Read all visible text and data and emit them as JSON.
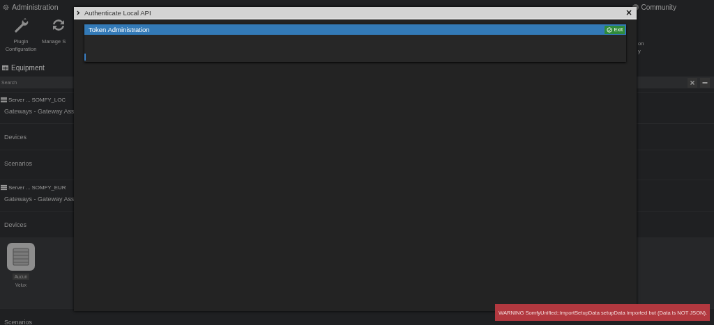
{
  "header": {
    "title": "Administration",
    "community": "Community"
  },
  "admin_tiles": [
    {
      "label": "Plugin Configuration"
    },
    {
      "label": "Manage S"
    }
  ],
  "right_fragments": [
    "on",
    "y"
  ],
  "equipment": {
    "title": "Equipment",
    "search": {
      "placeholder": "Search"
    }
  },
  "servers": [
    {
      "title": "Server ... SOMFY_LOC",
      "sections": [
        {
          "label": "Gateways - Gateway Ass"
        },
        {
          "label": "Devices"
        },
        {
          "label": "Scenarios"
        }
      ]
    },
    {
      "title": "Server ... SOMFY_EUR",
      "sections": [
        {
          "label": "Gateways - Gateway Ass"
        },
        {
          "label": "Devices",
          "devices": [
            {
              "status": "Aucun",
              "name": "Velux"
            }
          ]
        },
        {
          "label": "Scenarios"
        }
      ]
    }
  ],
  "modal": {
    "title": "Authenticate Local API",
    "close": "×",
    "panel": {
      "title": "Token Administration",
      "exit": "Exit"
    }
  },
  "toast": {
    "kind": "warning",
    "text": "WARNING SomfyUnified::importSetupData setupData imported but (Data is NOT JSON)."
  }
}
